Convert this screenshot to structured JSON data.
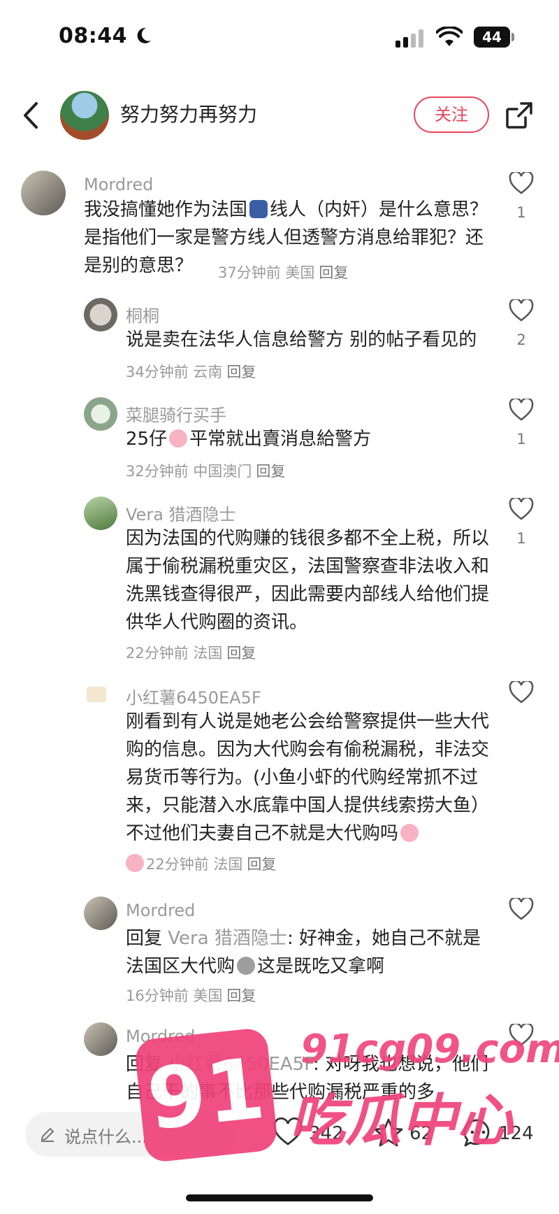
{
  "status": {
    "time": "08:44",
    "battery": "44"
  },
  "header": {
    "author": "努力努力再努力",
    "follow_label": "关注"
  },
  "comments": [
    {
      "name": "Mordred",
      "text_a": "我没搞懂她作为法国",
      "text_b": "线人（内奸）是什么意思？是指他们一家是警方线人但透警方消息给罪犯？还是别的意思？",
      "meta": "37分钟前 美国",
      "reply": "回复",
      "likes": "1"
    },
    {
      "name": "桐桐",
      "text": "说是卖在法华人信息给警方 别的帖子看见的",
      "meta": "34分钟前 云南",
      "reply": "回复",
      "likes": "2"
    },
    {
      "name": "菜腿骑行买手",
      "text_a": "25仔",
      "text_b": "平常就出賣消息給警方",
      "meta": "32分钟前 中国澳门",
      "reply": "回复",
      "likes": "1"
    },
    {
      "name": "Vera 猎酒隐士",
      "text": "因为法国的代购赚的钱很多都不全上税，所以属于偷税漏税重灾区，法国警察查非法收入和洗黑钱查得很严，因此需要内部线人给他们提供华人代购圈的资讯。",
      "meta": "22分钟前 法国",
      "reply": "回复",
      "likes": "1"
    },
    {
      "name": "小红薯6450EA5F",
      "text": "刚看到有人说是她老公会给警察提供一些大代购的信息。因为大代购会有偷税漏税，非法交易货币等行为。(小鱼小虾的代购经常抓不过来，只能潜入水底靠中国人提供线索捞大鱼）不过他们夫妻自己不就是大代购吗",
      "meta": "22分钟前 法国",
      "reply": "回复"
    },
    {
      "name": "Mordred",
      "reply_prefix": "回复",
      "reply_to": "Vera 猎酒隐士",
      "text_a": ": 好神金，她自己不就是法国区大代购",
      "text_b": "这是既吃又拿啊",
      "meta": "16分钟前 美国",
      "reply": "回复"
    },
    {
      "name": "Mordred",
      "reply_prefix": "回复",
      "reply_to": "小红薯6450EA5F",
      "text": ": 对呀我也想说，他们自己干的事不比那些代购漏税严重的多"
    }
  ],
  "bottom": {
    "placeholder": "说点什么...",
    "likes": "342",
    "stars": "62",
    "comments": "124"
  },
  "watermark": {
    "badge": "91",
    "url": "91cg09.com",
    "name": "吃瓜中心"
  },
  "colors": {
    "accent": "#e8455a",
    "meta": "#9a9a9a",
    "watermark": "#f0427a"
  }
}
